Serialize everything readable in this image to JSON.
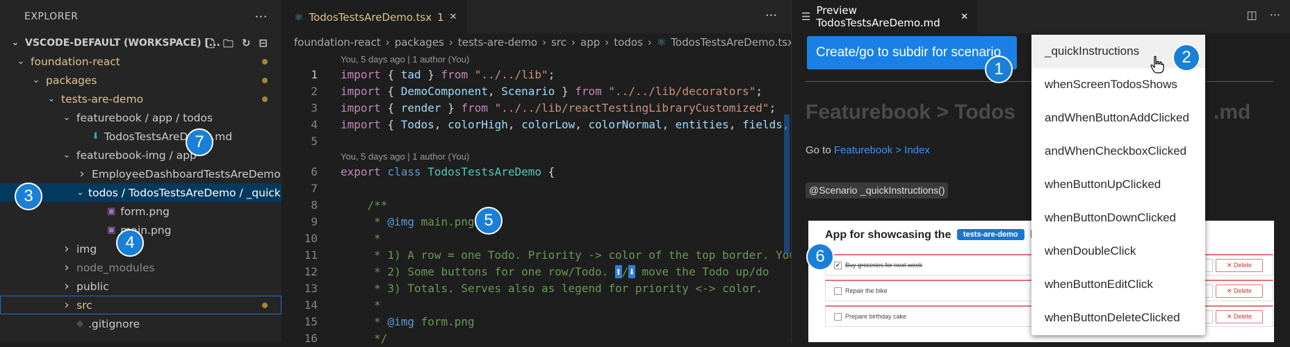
{
  "explorer": {
    "title": "EXPLORER",
    "more": "···",
    "workspace": "VSCODE-DEFAULT (WORKSPACE) [...",
    "tree": [
      {
        "label": "foundation-react",
        "indent": 0,
        "twisty": "v",
        "style": "git-mod",
        "dot": true
      },
      {
        "label": "packages",
        "indent": 1,
        "twisty": "v",
        "style": "git-mod",
        "dot": true
      },
      {
        "label": "tests-are-demo",
        "indent": 2,
        "twisty": "v",
        "style": "git-mod",
        "dot": true
      },
      {
        "label": "featurebook / app / todos",
        "indent": 3,
        "twisty": "v",
        "style": "",
        "dot": false
      },
      {
        "label": "TodosTestsAreDemo.md",
        "indent": 4,
        "twisty": "",
        "style": "",
        "dot": false,
        "icon": "md"
      },
      {
        "label": "featurebook-img / app",
        "indent": 3,
        "twisty": "v",
        "style": "",
        "dot": false
      },
      {
        "label": "EmployeeDashboardTestsAreDemo",
        "indent": 4,
        "twisty": ">",
        "style": "",
        "dot": false
      },
      {
        "label": "todos / TodosTestsAreDemo / _quickInstru...",
        "indent": 4,
        "twisty": "v",
        "style": "selected",
        "dot": false
      },
      {
        "label": "form.png",
        "indent": 5,
        "twisty": "",
        "style": "",
        "dot": false,
        "icon": "img"
      },
      {
        "label": "main.png",
        "indent": 5,
        "twisty": "",
        "style": "",
        "dot": false,
        "icon": "img"
      },
      {
        "label": "img",
        "indent": 3,
        "twisty": ">",
        "style": "",
        "dot": false
      },
      {
        "label": "node_modules",
        "indent": 3,
        "twisty": ">",
        "style": "muted",
        "dot": false
      },
      {
        "label": "public",
        "indent": 3,
        "twisty": ">",
        "style": "",
        "dot": false
      },
      {
        "label": "src",
        "indent": 3,
        "twisty": ">",
        "style": "git-mod outlined",
        "dot": true
      },
      {
        "label": ".gitignore",
        "indent": 3,
        "twisty": "",
        "style": "",
        "dot": false,
        "icon": "git"
      }
    ]
  },
  "editor": {
    "tab_label": "TodosTestsAreDemo.tsx",
    "tab_badge": "1",
    "tab_close": "✕",
    "more": "···",
    "breadcrumbs": [
      "foundation-react",
      "packages",
      "tests-are-demo",
      "src",
      "app",
      "todos",
      "TodosTestsAreDemo.tsx"
    ],
    "codelens_1": "You, 5 days ago | 1 author (You)",
    "codelens_2": "You, 5 days ago | 1 author (You)",
    "line_numbers": [
      "1",
      "2",
      "3",
      "4",
      "5",
      "6",
      "7",
      "8",
      "9",
      "10",
      "11",
      "12",
      "13",
      "14",
      "15",
      "16"
    ]
  },
  "preview": {
    "tab_label": "Preview TodosTestsAreDemo.md",
    "tab_close": "✕",
    "cta_label": "Create/go to subdir for scenario",
    "heading": "Featurebook > Todos",
    "heading_tail": ".md",
    "goto_prefix": "Go to",
    "goto_link": "Featurebook > Index",
    "chip_scenario": "@Scenario",
    "chip_method": "_quickInstructions()",
    "shot_title_prefix": "App for showcasing the",
    "shot_tag": "tests-are-demo",
    "shot_title_suffix": "libr",
    "todos": [
      {
        "text": "Buy groceries for next week",
        "done": true
      },
      {
        "text": "Repair the bike",
        "done": false
      },
      {
        "text": "Prepare birthday cake",
        "done": false
      }
    ],
    "delete_label": "✕ Delete"
  },
  "dropdown": {
    "items": [
      "_quickInstructions",
      "whenScreenTodosShows",
      "andWhenButtonAddClicked",
      "andWhenCheckboxClicked",
      "whenButtonUpClicked",
      "whenButtonDownClicked",
      "whenDoubleClick",
      "whenButtonEditClick",
      "whenButtonDeleteClicked"
    ]
  },
  "badges": [
    "1",
    "2",
    "3",
    "4",
    "5",
    "6",
    "7"
  ],
  "colors": {
    "accent": "#1a80e6",
    "selection": "#04395e",
    "git_modified": "#e2c08d"
  }
}
